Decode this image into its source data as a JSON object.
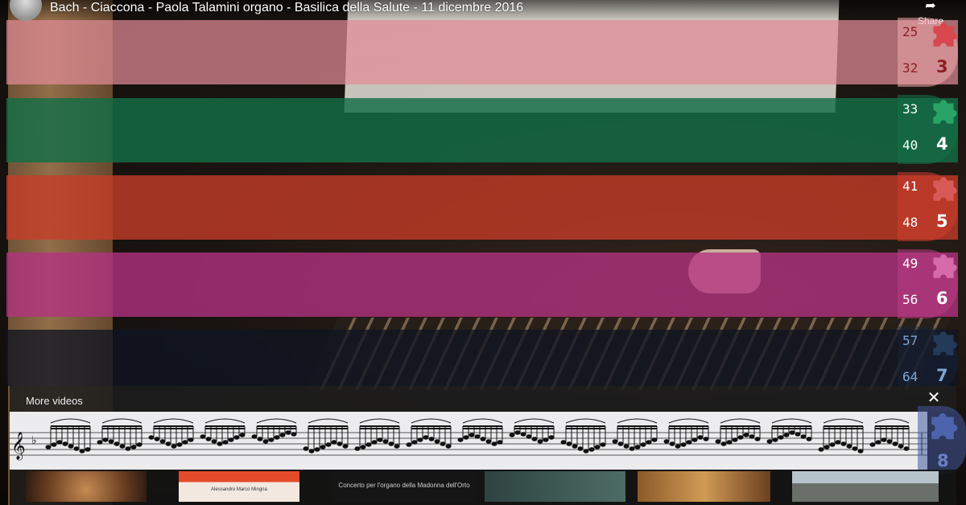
{
  "video": {
    "title": "Bach - Ciaccona - Paola Talamini organo - Basilica della Salute - 11 dicembre 2016",
    "share_label": "Share"
  },
  "measure_tabs": [
    {
      "start": "25",
      "end": "32",
      "section": "3",
      "color": "#e48c96"
    },
    {
      "start": "33",
      "end": "40",
      "section": "4",
      "color": "#146e46"
    },
    {
      "start": "41",
      "end": "48",
      "section": "5",
      "color": "#c83c28"
    },
    {
      "start": "49",
      "end": "56",
      "section": "6",
      "color": "#b43282"
    },
    {
      "start": "57",
      "end": "64",
      "section": "7",
      "color": "#7da7d9"
    },
    {
      "section": "8",
      "color": "#6b7fc4"
    }
  ],
  "more_videos": {
    "label": "More videos",
    "close_glyph": "✕",
    "thumbnails": [
      {
        "caption": ""
      },
      {
        "caption": "Alessandro Marco Mingna"
      },
      {
        "caption": "Concerto per l'organo della Madonna dell'Orto"
      },
      {
        "caption": ""
      },
      {
        "caption": ""
      },
      {
        "caption": ""
      }
    ]
  },
  "icons": {
    "share": "share-arrow-icon",
    "puzzle": "puzzle-piece-icon",
    "close": "close-icon",
    "avatar": "channel-avatar"
  }
}
